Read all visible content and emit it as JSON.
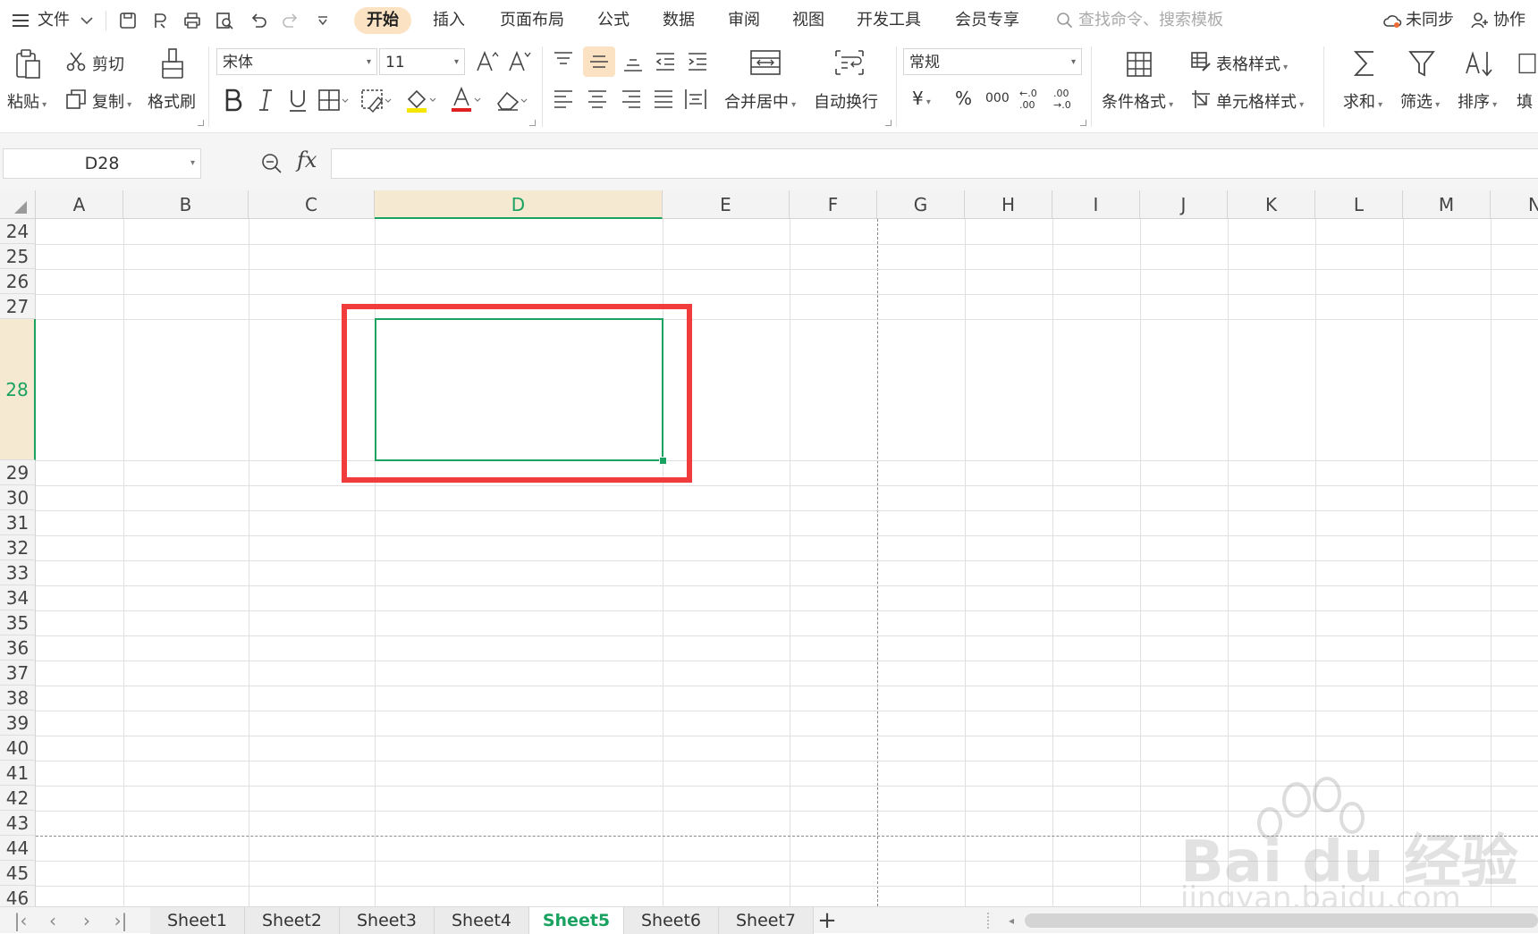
{
  "menubar": {
    "file_label": "文件",
    "tabs": [
      "开始",
      "插入",
      "页面布局",
      "公式",
      "数据",
      "审阅",
      "视图",
      "开发工具",
      "会员专享"
    ],
    "active_tab": "开始",
    "search_placeholder": "查找命令、搜索模板",
    "sync_label": "未同步",
    "collab_label": "协作"
  },
  "ribbon": {
    "paste_label": "粘贴",
    "cut_label": "剪切",
    "copy_label": "复制",
    "format_painter_label": "格式刷",
    "font_name": "宋体",
    "font_size": "11",
    "merge_center_label": "合并居中",
    "wrap_text_label": "自动换行",
    "number_format": "常规",
    "currency_symbol": "¥",
    "percent_symbol": "%",
    "thousands_symbol": "000",
    "inc_decimal_symbol": "←.0 .00",
    "dec_decimal_symbol": ".00 →.0",
    "conditional_format_label": "条件格式",
    "table_style_label": "表格样式",
    "cell_style_label": "单元格样式",
    "sum_label": "求和",
    "filter_label": "筛选",
    "sort_label": "排序",
    "fill_label": "填"
  },
  "formula_bar": {
    "name_box": "D28",
    "fx_label": "fx",
    "formula_value": ""
  },
  "grid": {
    "columns": [
      "A",
      "B",
      "C",
      "D",
      "E",
      "F",
      "G",
      "H",
      "I",
      "J",
      "K",
      "L",
      "M",
      "N"
    ],
    "rows": [
      "24",
      "25",
      "26",
      "27",
      "28",
      "29",
      "30",
      "31",
      "32",
      "33",
      "34",
      "35",
      "36",
      "37",
      "38",
      "39",
      "40",
      "41",
      "42",
      "43",
      "44",
      "45",
      "46"
    ],
    "selected_cell": "D28",
    "selected_column": "D",
    "selected_row": "28"
  },
  "sheets": {
    "tabs": [
      "Sheet1",
      "Sheet2",
      "Sheet3",
      "Sheet4",
      "Sheet5",
      "Sheet6",
      "Sheet7"
    ],
    "active": "Sheet5",
    "add_label": "+"
  },
  "watermark": {
    "brand": "Bai du 经验",
    "url": "jingyan.baidu.com"
  },
  "colors": {
    "accent_green": "#1aa260",
    "active_tab_bg": "#fbe2c2",
    "highlight_red": "#f03c3c"
  }
}
